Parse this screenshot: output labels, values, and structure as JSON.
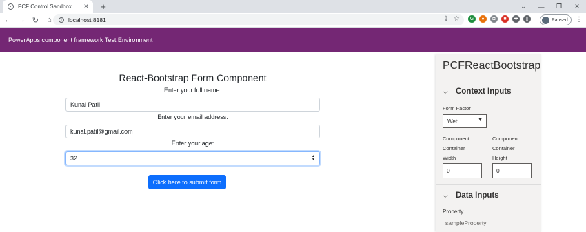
{
  "browser": {
    "tab_title": "PCF Control Sandbox",
    "tab_close": "✕",
    "new_tab": "+",
    "url": "localhost:8181",
    "profile_status": "Paused",
    "controls": {
      "minimize": "—",
      "maximize": "❐",
      "close": "✕",
      "dropdown": "⌄"
    }
  },
  "app": {
    "header_title": "PowerApps component framework Test Environment"
  },
  "form": {
    "title": "React-Bootstrap Form Component",
    "name_label": "Enter your full name:",
    "name_value": "Kunal Patil",
    "email_label": "Enter your email address:",
    "email_value": "kunal.patil@gmail.com",
    "age_label": "Enter your age:",
    "age_value": "32",
    "submit_label": "Click here to submit form"
  },
  "panel": {
    "title": "PCFReactBootstrap",
    "context_inputs": {
      "heading": "Context Inputs",
      "form_factor_label": "Form Factor",
      "form_factor_value": "Web",
      "width_label": [
        "Component",
        "Container",
        "Width"
      ],
      "width_value": "0",
      "height_label": [
        "Component",
        "Container",
        "Height"
      ],
      "height_value": "0"
    },
    "data_inputs": {
      "heading": "Data Inputs",
      "property_label": "Property",
      "property_value": "sampleProperty"
    }
  },
  "colors": {
    "header_bg": "#742774",
    "button_bg": "#0d6efd",
    "panel_bg": "#f3f2f1"
  }
}
